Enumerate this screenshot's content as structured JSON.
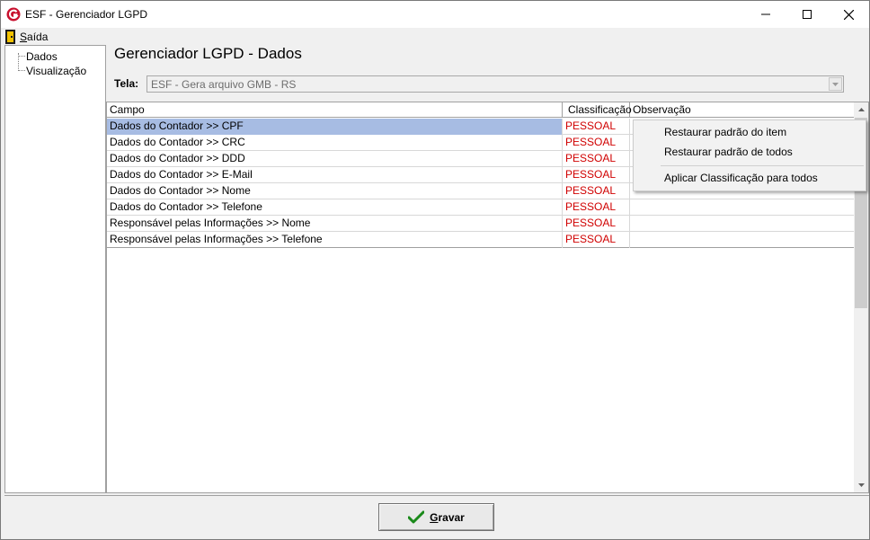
{
  "window": {
    "title": "ESF - Gerenciador LGPD"
  },
  "menu": {
    "items": [
      {
        "label": "Saída",
        "accel": "S",
        "rest": "aída"
      }
    ]
  },
  "tree": {
    "items": [
      {
        "label": "Dados"
      },
      {
        "label": "Visualização"
      }
    ]
  },
  "main": {
    "title": "Gerenciador LGPD - Dados",
    "tela_label": "Tela:",
    "tela_value": "ESF - Gera arquivo GMB - RS"
  },
  "grid": {
    "columns": [
      "Campo",
      "Classificação",
      "Observação"
    ],
    "rows": [
      {
        "campo": "Dados do Contador >> CPF",
        "classificacao": "PESSOAL",
        "observacao": ""
      },
      {
        "campo": "Dados do Contador >> CRC",
        "classificacao": "PESSOAL",
        "observacao": ""
      },
      {
        "campo": "Dados do Contador >> DDD",
        "classificacao": "PESSOAL",
        "observacao": ""
      },
      {
        "campo": "Dados do Contador >> E-Mail",
        "classificacao": "PESSOAL",
        "observacao": ""
      },
      {
        "campo": "Dados do Contador >> Nome",
        "classificacao": "PESSOAL",
        "observacao": ""
      },
      {
        "campo": "Dados do Contador >> Telefone",
        "classificacao": "PESSOAL",
        "observacao": ""
      },
      {
        "campo": "Responsável pelas Informações >> Nome",
        "classificacao": "PESSOAL",
        "observacao": ""
      },
      {
        "campo": "Responsável pelas Informações >> Telefone",
        "classificacao": "PESSOAL",
        "observacao": ""
      }
    ]
  },
  "context_menu": {
    "items": [
      "Restaurar padrão do item",
      "Restaurar padrão de todos",
      "Aplicar Classificação para todos"
    ]
  },
  "footer": {
    "gravar_label": "Gravar",
    "gravar_accel": "G",
    "gravar_rest": "ravar"
  },
  "colors": {
    "accent_selected": "#a7bce3",
    "classificacao_text": "#d00000",
    "logo": "#c8102e",
    "check": "#1a8a1a"
  },
  "icons": {
    "logo": "esf-logo-icon",
    "exit": "exit-door-icon",
    "save": "checkmark-icon"
  }
}
